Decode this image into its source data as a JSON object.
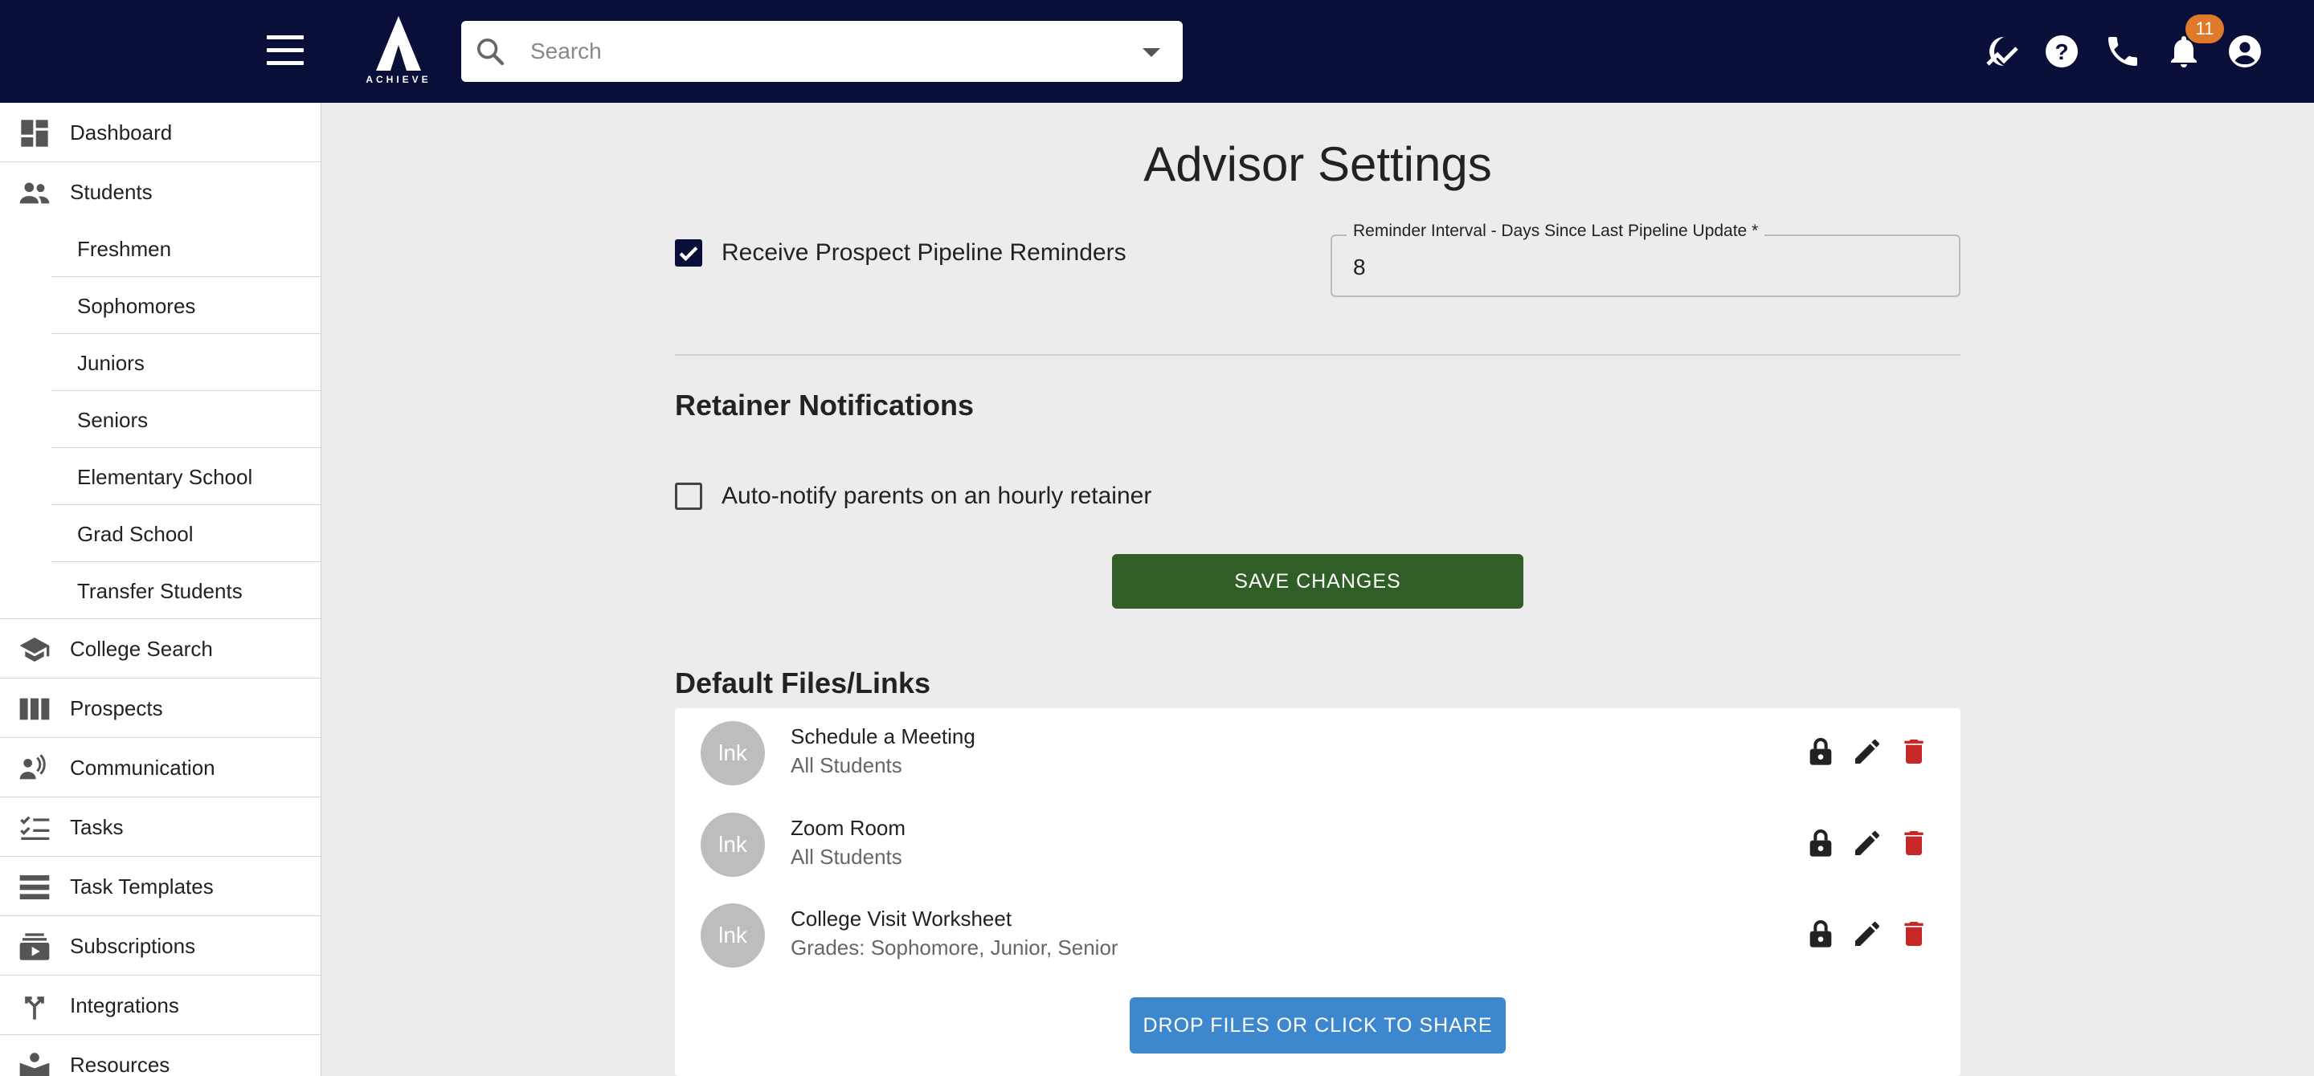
{
  "header": {
    "logo_text": "ACHIEVE",
    "search": {
      "placeholder": "Search"
    },
    "notifications_count": "11",
    "brand_color": "#0a0f3a"
  },
  "sidebar": {
    "items": [
      {
        "label": "Dashboard",
        "icon": "dashboard-icon"
      },
      {
        "label": "Students",
        "icon": "people-icon"
      },
      {
        "label": "College Search",
        "icon": "school-icon"
      },
      {
        "label": "Prospects",
        "icon": "columns-icon"
      },
      {
        "label": "Communication",
        "icon": "communication-icon"
      },
      {
        "label": "Tasks",
        "icon": "checklist-icon"
      },
      {
        "label": "Task Templates",
        "icon": "list-icon"
      },
      {
        "label": "Subscriptions",
        "icon": "subscriptions-icon"
      },
      {
        "label": "Integrations",
        "icon": "merge-icon"
      },
      {
        "label": "Resources",
        "icon": "resources-icon"
      }
    ],
    "student_subitems": [
      {
        "label": "Freshmen"
      },
      {
        "label": "Sophomores"
      },
      {
        "label": "Juniors"
      },
      {
        "label": "Seniors"
      },
      {
        "label": "Elementary School"
      },
      {
        "label": "Grad School"
      },
      {
        "label": "Transfer Students"
      }
    ]
  },
  "main": {
    "title": "Advisor Settings",
    "pipeline": {
      "checkbox_label": "Receive Prospect Pipeline Reminders",
      "checked": true,
      "interval_label": "Reminder Interval - Days Since Last Pipeline Update *",
      "interval_value": "8"
    },
    "retainer": {
      "heading": "Retainer Notifications",
      "checkbox_label": "Auto-notify parents on an hourly retainer",
      "checked": false
    },
    "save_label": "SAVE CHANGES",
    "files": {
      "heading": "Default Files/Links",
      "items": [
        {
          "avatar": "lnk",
          "title": "Schedule a Meeting",
          "subtitle": "All Students"
        },
        {
          "avatar": "lnk",
          "title": "Zoom Room",
          "subtitle": "All Students"
        },
        {
          "avatar": "lnk",
          "title": "College Visit Worksheet",
          "subtitle": "Grades: Sophomore, Junior, Senior"
        }
      ],
      "drop_label": "DROP FILES OR CLICK TO SHARE"
    }
  },
  "colors": {
    "save_button": "#2f5e27",
    "drop_button": "#3d87cf",
    "delete_icon": "#c62828",
    "badge": "#e07a2a"
  }
}
